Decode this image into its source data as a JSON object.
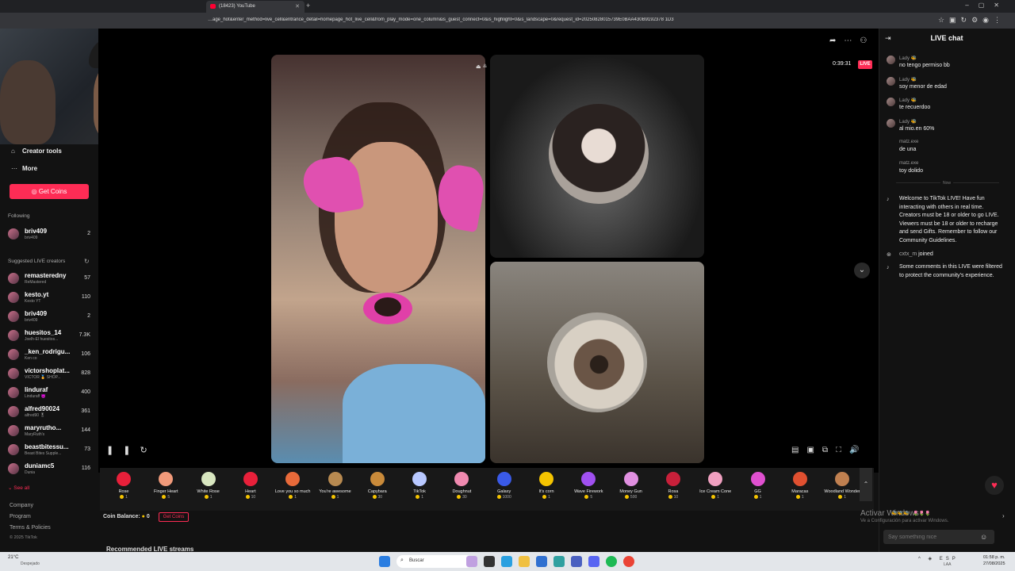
{
  "browser": {
    "tab_title": "(18423) YouTube",
    "url": "…age_hot&enter_method=live_cell&entrance_detail=homepage_hot_live_cell&from_play_mode=one_column&is_guest_connect=0&is_highlight=0&is_landscape=0&request_id=20250828015739E0BAA430B9192378 1D3"
  },
  "sidebar": {
    "creator_tools": "Creator tools",
    "more": "More",
    "get_coins": "Get Coins",
    "following_title": "Following",
    "following": [
      {
        "name": "briv409",
        "sub": "briv409",
        "count": "2"
      }
    ],
    "suggested_title": "Suggested LIVE creators",
    "suggested": [
      {
        "name": "remasteredny",
        "sub": "ReMastered",
        "count": "57"
      },
      {
        "name": "kesto.yt",
        "sub": "Kesto YT",
        "count": "110"
      },
      {
        "name": "briv409",
        "sub": "briv409",
        "count": "2"
      },
      {
        "name": "huesitos_14",
        "sub": "Joelh-El huesitos...",
        "count": "7.3K"
      },
      {
        "name": "_ken_rodrigu...",
        "sub": "Ken co",
        "count": "106"
      },
      {
        "name": "victorshoplat...",
        "sub": "VICTOR 🏅 SHOP...",
        "count": "828"
      },
      {
        "name": "linduraf",
        "sub": "Linduraff 😈",
        "count": "400"
      },
      {
        "name": "alfred90024",
        "sub": "alfred90 🎖",
        "count": "361"
      },
      {
        "name": "maryrutho...",
        "sub": "MaryRuth's",
        "count": "144"
      },
      {
        "name": "beastbitessu...",
        "sub": "Beast Bites Supple...",
        "count": "73"
      },
      {
        "name": "duniamc5",
        "sub": "Dunia",
        "count": "116"
      }
    ],
    "see_all": "See all",
    "footer": [
      "Company",
      "Program",
      "Terms & Policies",
      "© 2025 TikTok"
    ]
  },
  "stream": {
    "timer": "0:39:31",
    "live_label": "LIVE"
  },
  "gifts": [
    {
      "name": "Rose",
      "price": "1",
      "color": "#e8203a"
    },
    {
      "name": "Finger Heart",
      "price": "5",
      "color": "#f19a7a"
    },
    {
      "name": "White Rose",
      "price": "1",
      "color": "#d8e6c0"
    },
    {
      "name": "Heart",
      "price": "10",
      "color": "#e8203a"
    },
    {
      "name": "Love you so much",
      "price": "1",
      "color": "#e86a3a"
    },
    {
      "name": "You're awesome",
      "price": "1",
      "color": "#b88a50"
    },
    {
      "name": "Capybara",
      "price": "30",
      "color": "#c98a3a"
    },
    {
      "name": "TikTok",
      "price": "1",
      "color": "#b8c8ff"
    },
    {
      "name": "Doughnut",
      "price": "30",
      "color": "#f08ab0"
    },
    {
      "name": "Galaxy",
      "price": "1000",
      "color": "#3a5ae8"
    },
    {
      "name": "It's corn",
      "price": "1",
      "color": "#f5c400"
    },
    {
      "name": "Wave Firework",
      "price": "5",
      "color": "#a050f0"
    },
    {
      "name": "Money Gun",
      "price": "500",
      "color": "#e090e0"
    },
    {
      "name": "Rosa",
      "price": "10",
      "color": "#c8203a"
    },
    {
      "name": "Ice Cream Cone",
      "price": "1",
      "color": "#f0a0c0"
    },
    {
      "name": "GG",
      "price": "1",
      "color": "#e050d0"
    },
    {
      "name": "Maracas",
      "price": "1",
      "color": "#e05030"
    },
    {
      "name": "Woodland Wonder",
      "price": "1",
      "color": "#c08050"
    }
  ],
  "balance": {
    "label": "Coin Balance:",
    "value": "0",
    "get_coins": "Get Coins"
  },
  "recommended_title": "Recommended LIVE streams",
  "chat": {
    "title": "LIVE chat",
    "messages": [
      {
        "user": "Lady 🐝",
        "text": "no tengo permiso bb"
      },
      {
        "user": "Lady 🐝",
        "text": "soy menor de edad"
      },
      {
        "user": "Lady 🐝",
        "text": "te recuerdoo"
      },
      {
        "user": "Lady 🐝",
        "text": "al mio.en 60%"
      },
      {
        "user": "matz.exe",
        "text": "de una"
      },
      {
        "user": "matz.exe",
        "text": "toy dolido"
      }
    ],
    "now_label": "Now",
    "welcome": "Welcome to TikTok LIVE! Have fun interacting with others in real time. Creators must be 18 or older to go LIVE. Viewers must be 18 or older to recharge and send Gifts. Remember to follow our Community Guidelines.",
    "joined_user": "cxtx_m",
    "joined_text": "joined",
    "filtered": "Some comments in this LIVE were filtered to protect the community's experience.",
    "input_placeholder": "Say something nice"
  },
  "overlay": {
    "activate_title": "Activar Windows",
    "activate_sub": "Ve a Configuración para activar Windows."
  },
  "taskbar": {
    "weather_temp": "21°C",
    "weather_desc": "Despejado",
    "search": "Buscar",
    "lang": "ESP",
    "lang2": "LAA",
    "time": "01:58 p. m.",
    "date": "27/08/2025"
  }
}
